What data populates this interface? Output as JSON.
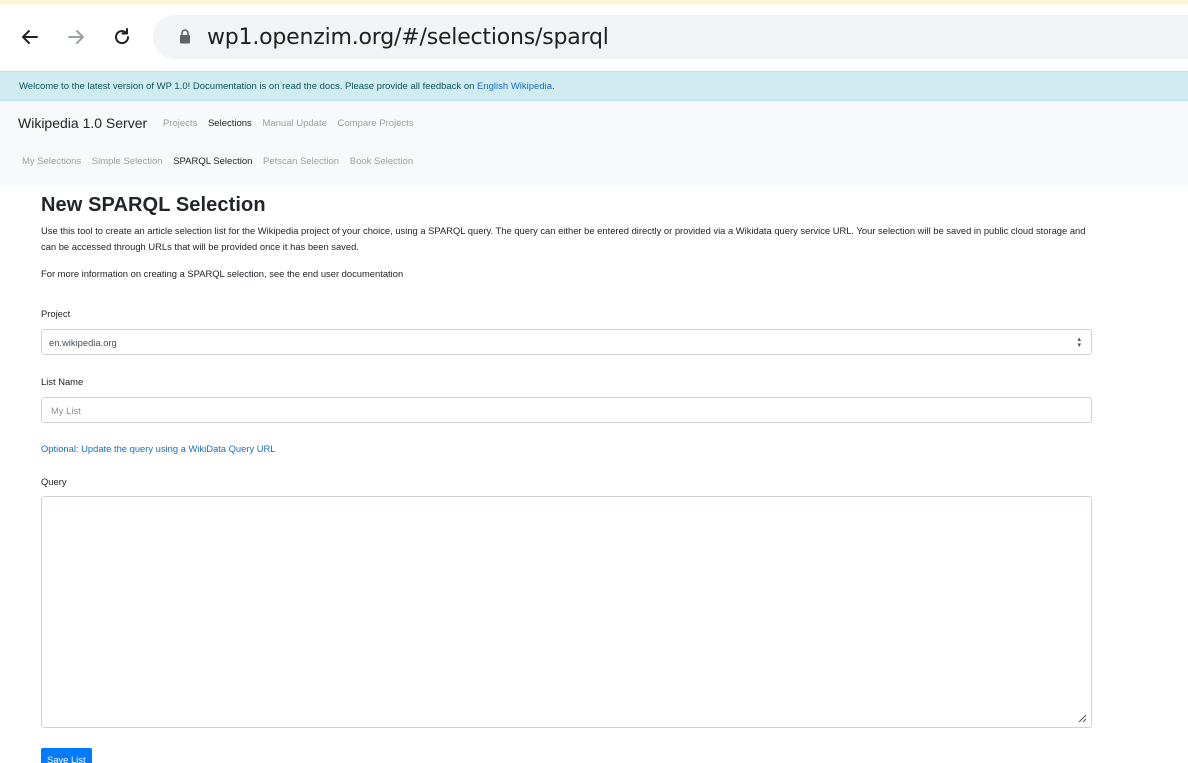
{
  "browser": {
    "url_host": "wp1.openzim.org",
    "url_path": "/#/selections/sparql"
  },
  "alert": {
    "text_1": "Welcome to the latest version of WP 1.0! Documentation is on ",
    "docs_link": "read the docs",
    "text_2": ". Please provide all feedback on ",
    "feedback_link": "English Wikipedia",
    "text_3": "."
  },
  "header": {
    "brand": "Wikipedia 1.0 Server",
    "nav": [
      "Projects",
      "Selections",
      "Manual Update",
      "Compare Projects"
    ],
    "active_nav": "Selections",
    "subnav": [
      "My Selections",
      "Simple Selection",
      "SPARQL Selection",
      "Petscan Selection",
      "Book Selection"
    ],
    "active_subnav": "SPARQL Selection"
  },
  "page": {
    "title": "New SPARQL Selection",
    "intro": "Use this tool to create an article selection list for the Wikipedia project of your choice, using a SPARQL query. The query can either be entered directly or provided via a Wikidata query service URL. Your selection will be saved in public cloud storage and can be accessed through URLs that will be provided once it has been saved.",
    "more_info": "For more information on creating a SPARQL selection, see the end user documentation"
  },
  "form": {
    "project_label": "Project",
    "project_value": "en.wikipedia.org",
    "list_name_label": "List Name",
    "list_name_placeholder": "My List",
    "optional_link": "Optional: Update the query using a WikiData Query URL",
    "query_label": "Query",
    "query_value": "",
    "save_button": "Save List"
  },
  "colors": {
    "alert_bg": "#d1ecf1",
    "link": "#1b6ec2",
    "primary_button": "#007bff",
    "header_bg": "#f8f9fa"
  }
}
